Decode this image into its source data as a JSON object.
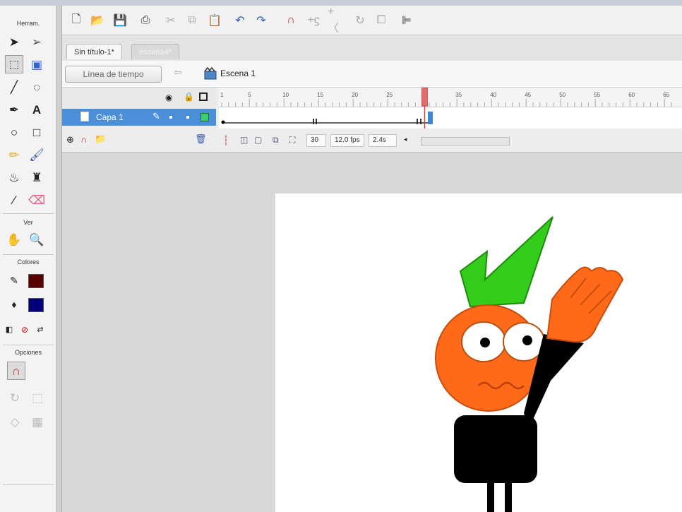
{
  "tools_panel": {
    "herramientas_title": "Herram.",
    "ver_title": "Ver",
    "colores_title": "Colores",
    "opciones_title": "Opciones",
    "stroke_color": "#5a0000",
    "fill_color": "#00007a"
  },
  "document": {
    "active_tab": "Sin título-1*",
    "inactive_tab": "escena4*"
  },
  "editbar": {
    "timeline_button": "Línea de tiempo",
    "scene_label": "Escena 1"
  },
  "timeline": {
    "layer_name": "Capa 1",
    "ruler_labels": [
      "1",
      "5",
      "10",
      "15",
      "20",
      "25",
      "30",
      "35",
      "40",
      "45",
      "50",
      "55",
      "60",
      "65"
    ],
    "current_frame": "30",
    "frame_rate": "12.0 fps",
    "elapsed_time": "2.4s"
  },
  "colors": {
    "accent": "#4a8fd8",
    "playhead": "#e26b6b",
    "head": "#ff6a1a",
    "hair": "#33cc1a",
    "body": "#000000"
  }
}
